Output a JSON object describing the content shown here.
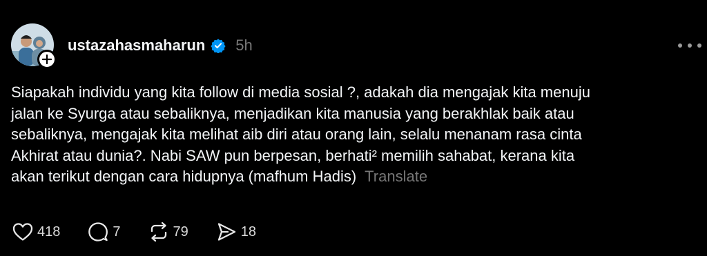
{
  "post": {
    "username": "ustazahasmaharun",
    "timestamp": "5h",
    "caption_lines": [
      "Siapakah individu yang kita follow di media sosial ?, adakah dia mengajak kita menuju",
      "jalan ke Syurga atau sebaliknya, menjadikan kita manusia yang berakhlak baik atau",
      "sebaliknya, mengajak kita melihat aib diri atau orang lain, selalu menanam rasa cinta",
      "Akhirat atau dunia?. Nabi SAW pun berpesan, berhati² memilih sahabat, kerana kita",
      "akan terikut dengan cara hidupnya (mafhum Hadis)"
    ],
    "translate_label": "Translate",
    "verified_badge": "verified-icon",
    "follow_badge": "plus-icon"
  },
  "actions": {
    "likes": "418",
    "comments": "7",
    "reposts": "79",
    "shares": "18"
  },
  "colors": {
    "background": "#000000",
    "text_primary": "#f3f5f7",
    "text_secondary": "#777777",
    "verified": "#0095f6"
  }
}
